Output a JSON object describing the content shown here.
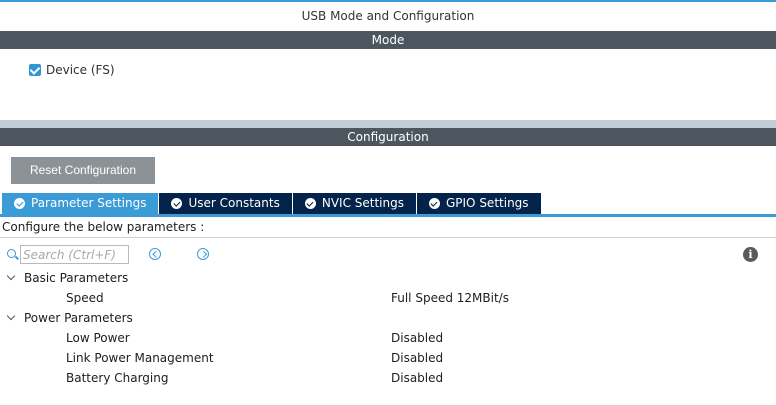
{
  "window": {
    "title": "USB Mode and Configuration"
  },
  "mode": {
    "header": "Mode",
    "device_checkbox": {
      "label": "Device (FS)",
      "checked": true
    }
  },
  "configuration": {
    "header": "Configuration",
    "reset_button": "Reset Configuration",
    "tabs": [
      {
        "label": "Parameter Settings",
        "active": true,
        "icon": "check-circle-icon"
      },
      {
        "label": "User Constants",
        "active": false,
        "icon": "check-circle-icon"
      },
      {
        "label": "NVIC Settings",
        "active": false,
        "icon": "check-circle-icon"
      },
      {
        "label": "GPIO Settings",
        "active": false,
        "icon": "check-circle-icon"
      }
    ],
    "configure_text": "Configure the below parameters :",
    "search": {
      "placeholder": "Search (Ctrl+F)",
      "value": ""
    },
    "tree": {
      "basic": {
        "label": "Basic Parameters",
        "params": [
          {
            "name": "Speed",
            "value": "Full Speed 12MBit/s"
          }
        ]
      },
      "power": {
        "label": "Power Parameters",
        "params": [
          {
            "name": "Low Power",
            "value": "Disabled"
          },
          {
            "name": "Link Power Management",
            "value": "Disabled"
          },
          {
            "name": "Battery Charging",
            "value": "Disabled"
          }
        ]
      }
    }
  },
  "colors": {
    "accent": "#3a9bd6",
    "tab_dark": "#03234b",
    "section_bar": "#4d565e",
    "button_gray": "#8d9296"
  }
}
